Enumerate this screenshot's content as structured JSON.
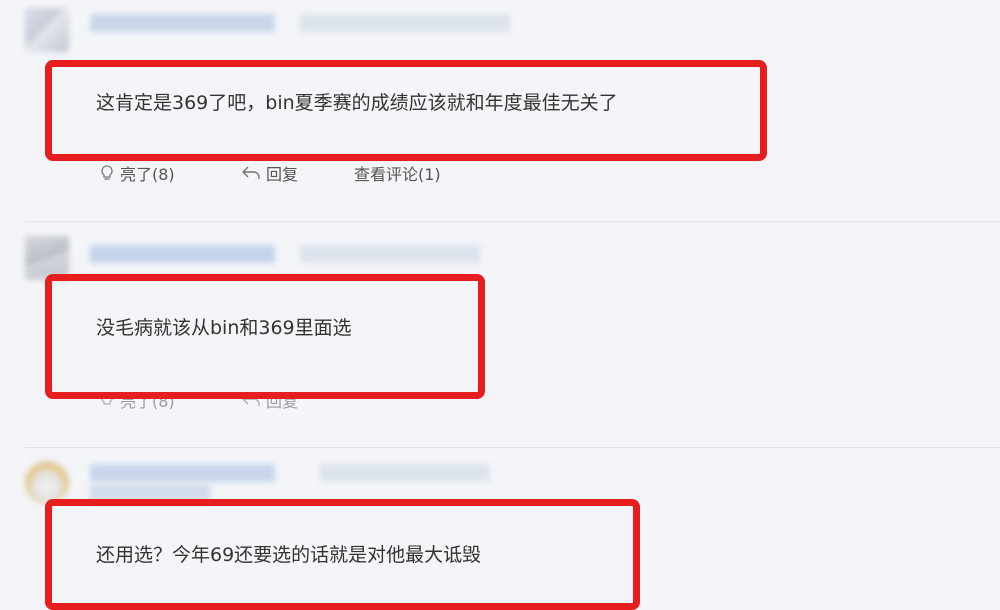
{
  "comments": [
    {
      "text": "这肯定是369了吧，bin夏季赛的成绩应该就和年度最佳无关了",
      "actions": {
        "like_label": "亮了(8)",
        "reply_label": "回复",
        "view_replies_label": "查看评论(1)"
      }
    },
    {
      "text": "没毛病就该从bin和369里面选",
      "actions": {
        "like_label": "亮了(8)",
        "reply_label": "回复"
      }
    },
    {
      "text": "还用选？今年69还要选的话就是对他最大诋毁"
    }
  ],
  "colors": {
    "highlight_border": "#e81d1d",
    "background": "#f3f5f9",
    "divider": "#e0e3ea"
  },
  "icons": {
    "like": "lightbulb-icon",
    "reply": "reply-arrow-icon"
  }
}
